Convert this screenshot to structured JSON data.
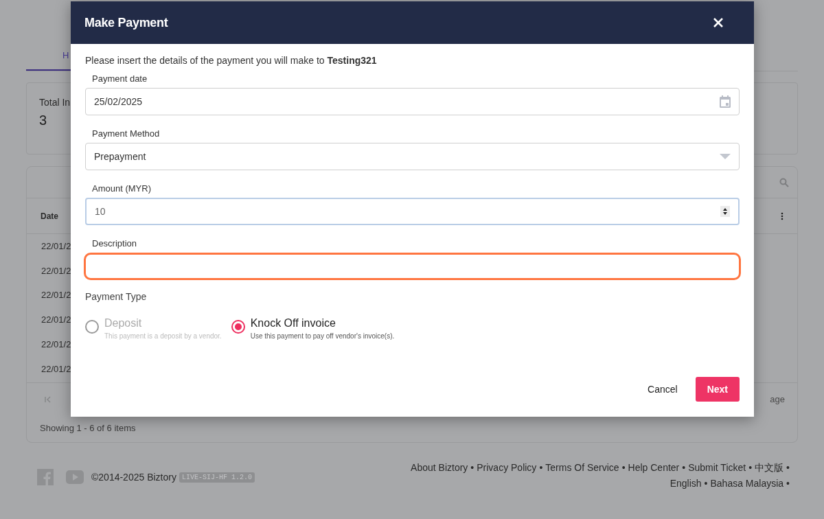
{
  "page": {
    "tab": "H",
    "stat": {
      "label": "Total In",
      "value": "3"
    },
    "table": {
      "column": "Date",
      "rows": [
        "22/01/2",
        "22/01/2",
        "22/01/2",
        "22/01/2",
        "22/01/2",
        "22/01/2"
      ],
      "pager_text": "age",
      "summary": "Showing 1 - 6 of 6 items"
    },
    "footer": {
      "copyright": "©2014-2025 Biztory",
      "version": "LIVE-SIJ-HF 1.2.0",
      "separator": "•",
      "links": [
        "About Biztory",
        "Privacy Policy",
        "Terms Of Service",
        "Help Center",
        "Submit Ticket",
        "中文版",
        "English",
        "Bahasa Malaysia"
      ]
    }
  },
  "dialog": {
    "title": "Make Payment",
    "intro": "Please insert the details of the payment you will make to **Testing321**",
    "fields": [
      {
        "kind": "date",
        "label": "Payment date",
        "value": "25/02/2025",
        "focused": false,
        "highlighted": false
      },
      {
        "kind": "select",
        "label": "Payment Method",
        "value": "Prepayment",
        "focused": false,
        "highlighted": false
      },
      {
        "kind": "number",
        "label": "Amount (MYR)",
        "value": "10",
        "focused": true,
        "highlighted": false
      },
      {
        "kind": "text",
        "label": "Description",
        "focused": false,
        "highlighted": true
      }
    ],
    "payment_type": {
      "label": "Payment Type",
      "options": [
        {
          "label": "Deposit",
          "hint": "This payment is a deposit by a vendor.",
          "selected": false,
          "disabled": true
        },
        {
          "label": "Knock Off invoice",
          "hint": "Use this payment to pay off vendor's invoice(s).",
          "selected": true,
          "disabled": false
        }
      ]
    },
    "buttons": [
      {
        "kind": "text",
        "label": "Cancel"
      },
      {
        "kind": "primary",
        "label": "Next"
      }
    ]
  }
}
